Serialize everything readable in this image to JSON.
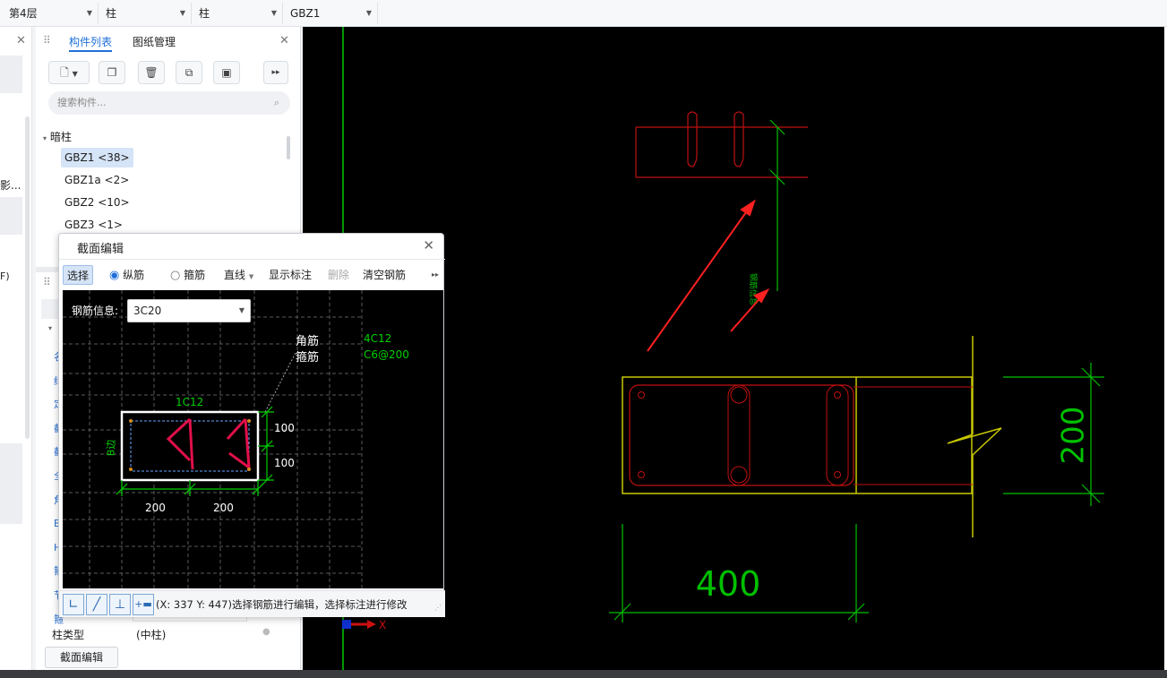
{
  "toolbar": {
    "floor": "第4层",
    "category": "柱",
    "type": "柱",
    "component": "GBZ1"
  },
  "left_strip": {
    "text1": "影...",
    "text2": "F)"
  },
  "panel": {
    "tab_components": "构件列表",
    "tab_drawings": "图纸管理",
    "search_placeholder": "搜索构件...",
    "group": "暗柱",
    "items": [
      "GBZ1 <38>",
      "GBZ1a <2>",
      "GBZ2 <10>",
      "GBZ3 <1>"
    ],
    "prop_label": "柱类型",
    "prop_value": "(中柱)",
    "section_edit_button": "截面编辑",
    "prop_chars": [
      "名",
      "结",
      "定",
      "截",
      "截",
      "全",
      "角",
      "B",
      "H",
      "箍",
      "节",
      "箍"
    ]
  },
  "dialog": {
    "title": "截面编辑",
    "btn_select": "选择",
    "radio_longitudinal": "纵筋",
    "radio_stirrup": "箍筋",
    "btn_line": "直线",
    "btn_show_label": "显示标注",
    "btn_delete": "删除",
    "btn_clear": "清空钢筋",
    "rebar_info_label": "钢筋信息:",
    "rebar_info_value": "3C20",
    "label_corner": "角筋",
    "label_stirrup": "箍筋",
    "value_corner": "4C12",
    "value_stirrup": "C6@200",
    "top_rebar": "1C12",
    "side_label": "B边",
    "dim_100a": "100",
    "dim_100b": "100",
    "dim_200a": "200",
    "dim_200b": "200",
    "status": "(X: 337 Y: 447)选择钢筋进行编辑，选择标注进行修改"
  },
  "drawing": {
    "dim_400": "400",
    "dim_200": "200",
    "small_note": "钢筋信息",
    "axis_x": "X"
  },
  "colors": {
    "accent": "#1e6fd9",
    "cad_green": "#00d000",
    "cad_red": "#d01010",
    "cad_yellow": "#c8c800"
  }
}
